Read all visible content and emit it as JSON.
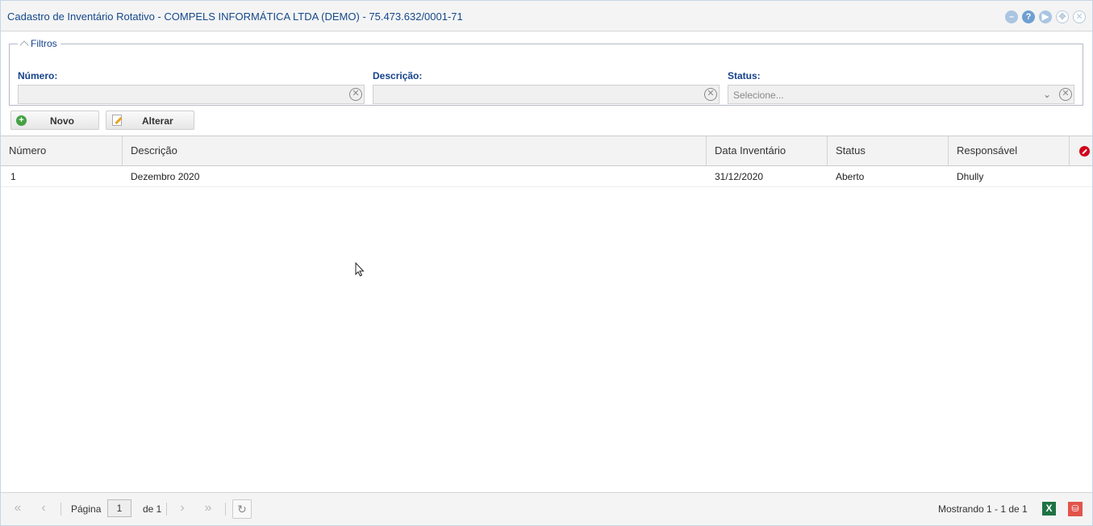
{
  "window": {
    "title": "Cadastro de Inventário Rotativo - COMPELS INFORMÁTICA LTDA (DEMO) - 75.473.632/0001-71",
    "tools": [
      {
        "icon": "minimize-icon",
        "glyph": "–"
      },
      {
        "icon": "help-icon",
        "glyph": "?"
      },
      {
        "icon": "next-icon",
        "glyph": "▶"
      },
      {
        "icon": "restore-icon",
        "glyph": "✥"
      },
      {
        "icon": "close-icon",
        "glyph": "✕"
      }
    ]
  },
  "filters": {
    "legend": "Filtros",
    "numero": {
      "label": "Número:",
      "value": ""
    },
    "descricao": {
      "label": "Descrição:",
      "value": ""
    },
    "status": {
      "label": "Status:",
      "placeholder": "Selecione..."
    }
  },
  "toolbar": {
    "novo_label": "Novo",
    "alterar_label": "Alterar"
  },
  "grid": {
    "columns": [
      "Número",
      "Descrição",
      "Data Inventário",
      "Status",
      "Responsável"
    ],
    "rows": [
      {
        "numero": "1",
        "descricao": "Dezembro 2020",
        "data": "31/12/2020",
        "status": "Aberto",
        "responsavel": "Dhully"
      }
    ]
  },
  "pager": {
    "page_label": "Página",
    "page_value": "1",
    "of_label": "de 1",
    "showing": "Mostrando 1 - 1 de 1",
    "export_xls": "X",
    "export_pdf": "⛁"
  },
  "colors": {
    "title": "#15498b",
    "accent": "#15428b",
    "excel": "#1f7244",
    "pdf": "#e2544b"
  }
}
